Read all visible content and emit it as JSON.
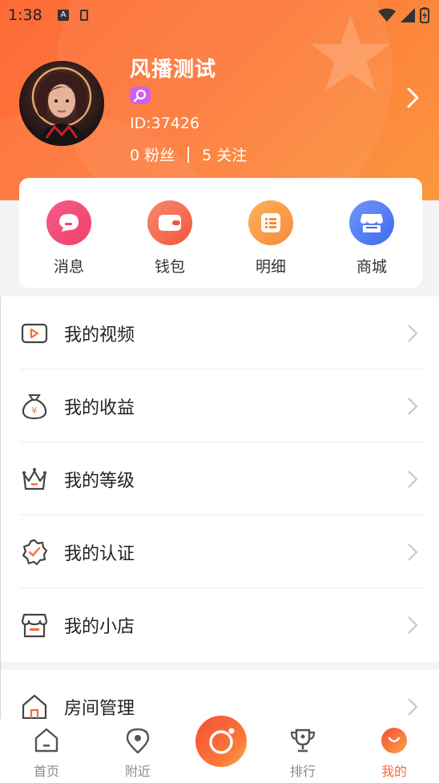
{
  "status_bar": {
    "time": "1:38",
    "a_icon": "A"
  },
  "profile": {
    "name": "风播测试",
    "id": "ID:37426",
    "fans": "0 粉丝",
    "follows": "5 关注"
  },
  "quick_actions": [
    {
      "label": "消息",
      "icon": "message-icon",
      "color": "#f44b7b"
    },
    {
      "label": "钱包",
      "icon": "wallet-icon",
      "color": "#f6664f"
    },
    {
      "label": "明细",
      "icon": "list-icon",
      "color": "#fa9a3c"
    },
    {
      "label": "商城",
      "icon": "store-icon",
      "color": "#4f7ff4"
    }
  ],
  "menu": [
    {
      "label": "我的视频",
      "icon": "video-icon"
    },
    {
      "label": "我的收益",
      "icon": "money-bag-icon"
    },
    {
      "label": "我的等级",
      "icon": "crown-icon"
    },
    {
      "label": "我的认证",
      "icon": "verified-badge-icon"
    },
    {
      "label": "我的小店",
      "icon": "shop-icon"
    },
    {
      "label": "房间管理",
      "icon": "home-room-icon"
    }
  ],
  "tabs": [
    {
      "label": "首页",
      "icon": "home-icon",
      "active": false
    },
    {
      "label": "附近",
      "icon": "location-pin-icon",
      "active": false
    },
    {
      "label": "排行",
      "icon": "trophy-icon",
      "active": false
    },
    {
      "label": "我的",
      "icon": "profile-smile-icon",
      "active": true
    }
  ],
  "colors": {
    "accent": "#fb6a38",
    "header_start": "#fd6a37",
    "header_end": "#fb9a3f"
  }
}
